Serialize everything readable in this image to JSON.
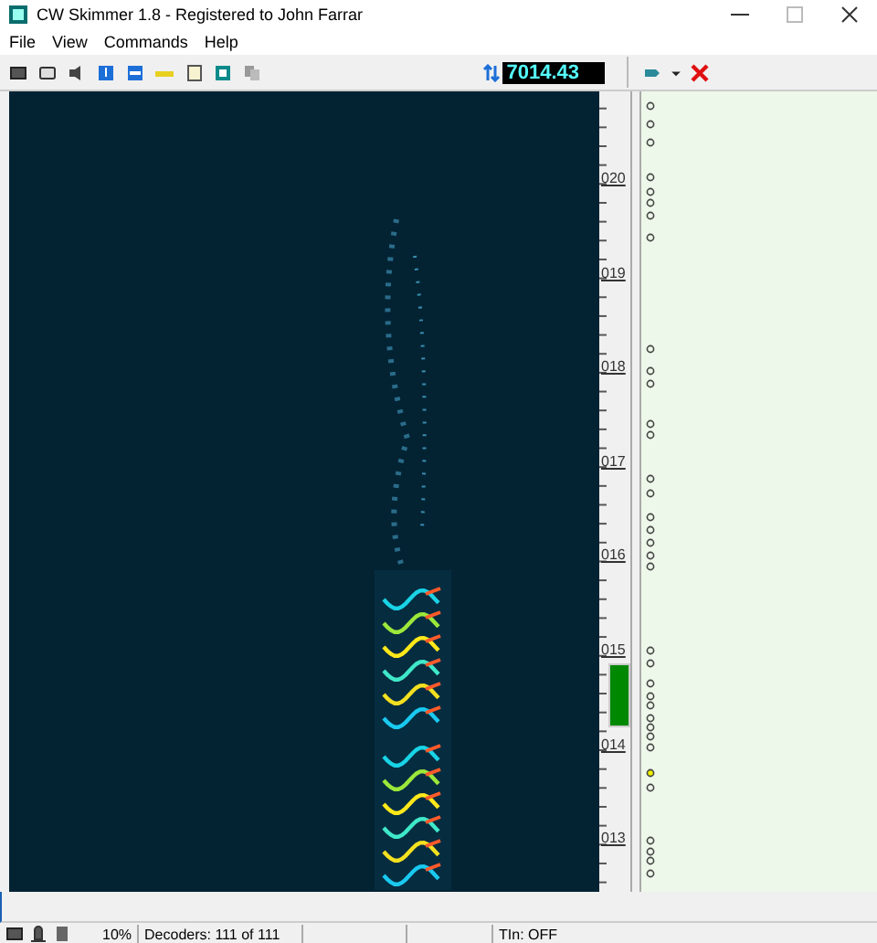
{
  "window": {
    "title": "CW Skimmer 1.8 - Registered to John Farrar"
  },
  "menu": [
    "File",
    "View",
    "Commands",
    "Help"
  ],
  "frequency": "7014.43",
  "scale_labels": [
    "020",
    "019",
    "018",
    "017",
    "016",
    "015",
    "014",
    "013"
  ],
  "status_bar": {
    "zoom": "10%",
    "decoders": "Decoders: 111 of 111",
    "tln": "TIn: OFF"
  }
}
